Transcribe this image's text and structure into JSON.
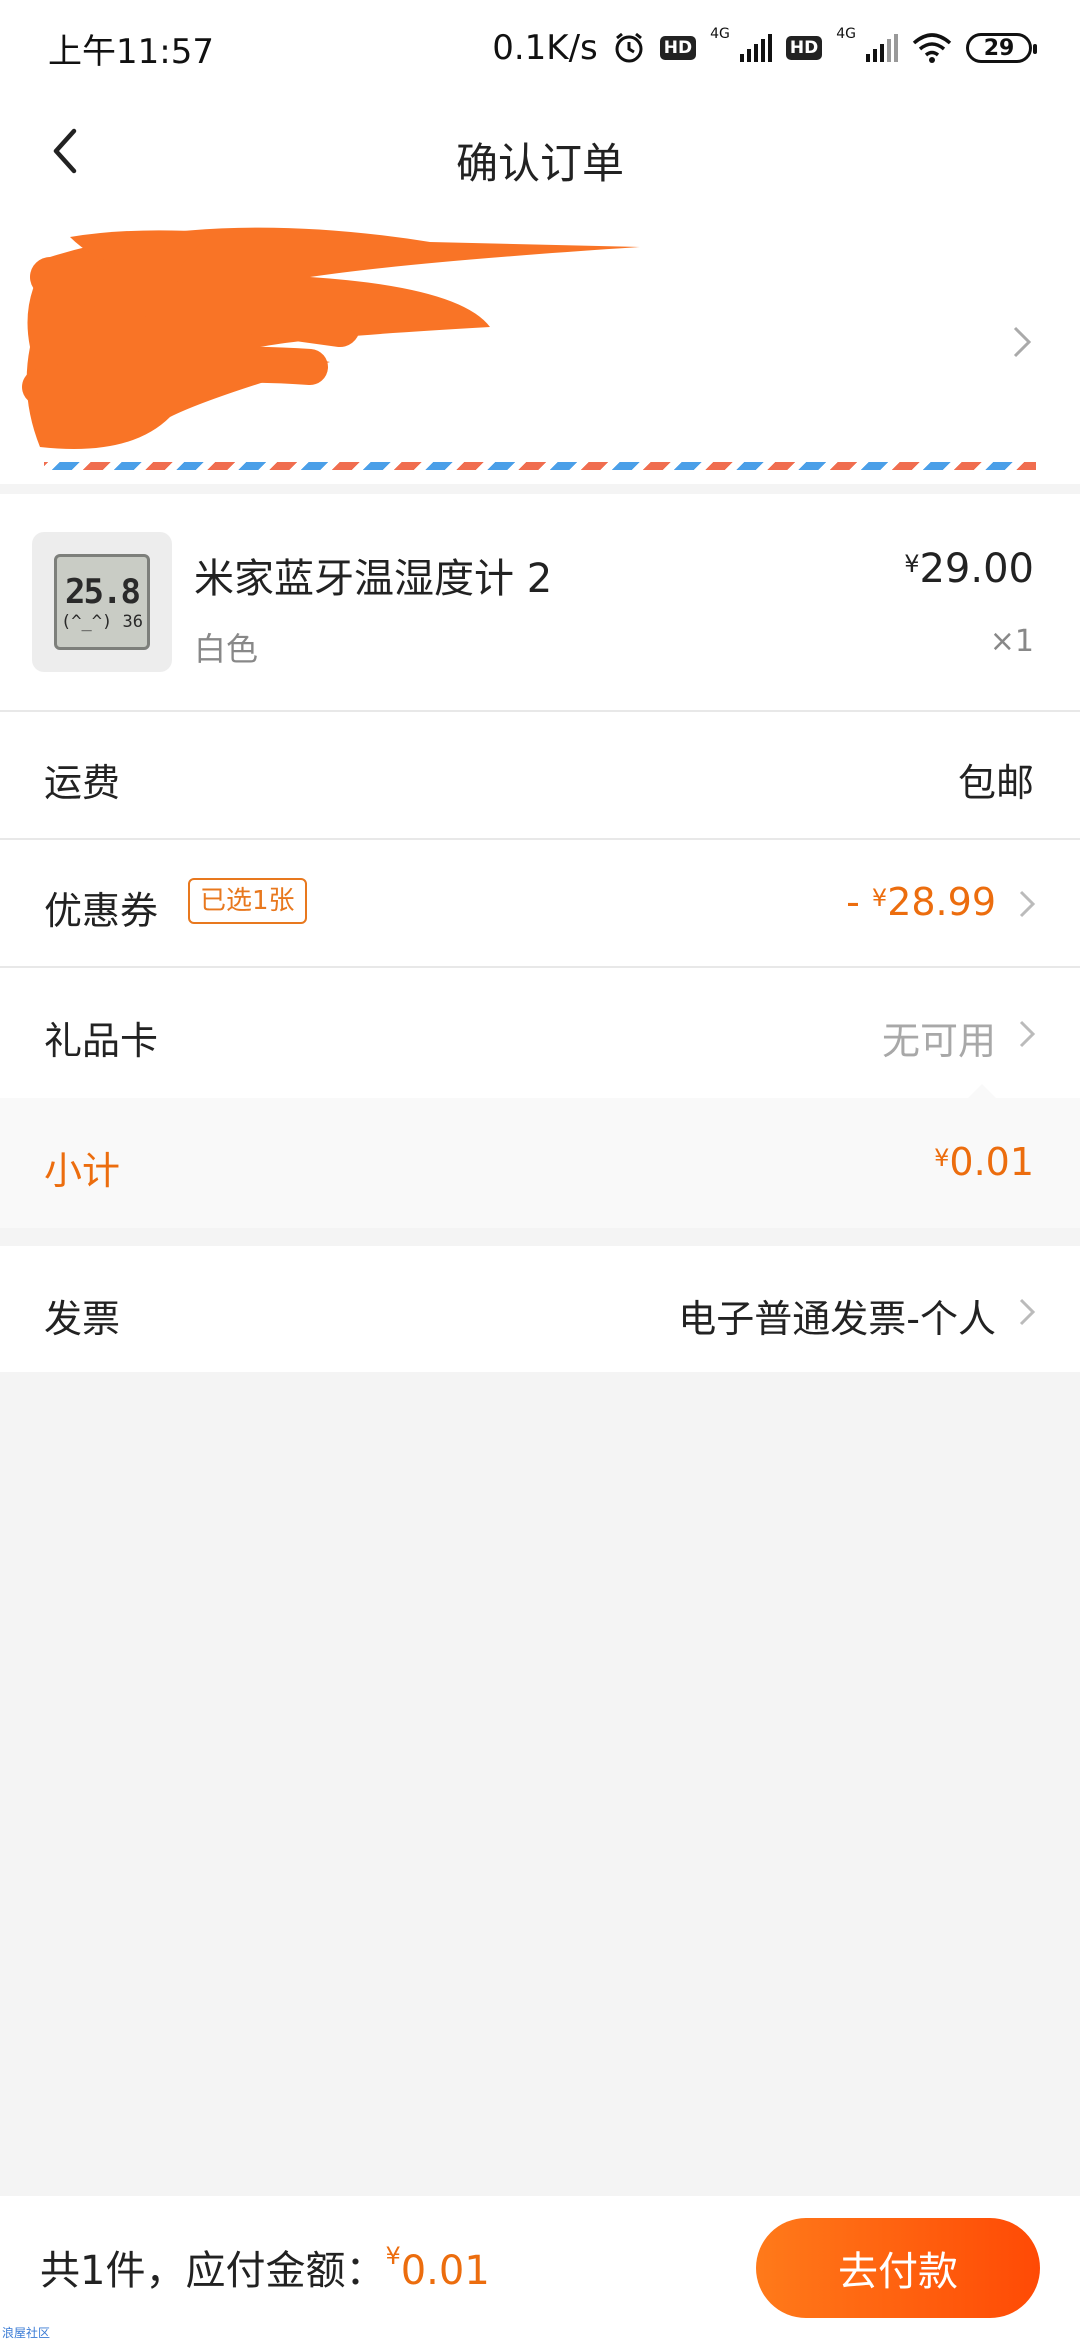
{
  "status_bar": {
    "time": "上午11:57",
    "net_speed": "0.1K/s",
    "hd1": "HD",
    "net1": "4G",
    "hd2": "HD",
    "net2": "4G",
    "battery": "29",
    "icons": [
      "alarm-icon",
      "signal-icon",
      "wifi-icon",
      "battery-icon"
    ]
  },
  "header": {
    "title": "确认订单"
  },
  "product": {
    "name": "米家蓝牙温湿度计 2",
    "variant": "白色",
    "price_symbol": "¥",
    "price": "29.00",
    "quantity": "×1",
    "thumb_temp": "25.8",
    "thumb_humidity": "(^_^) 36"
  },
  "shipping": {
    "label": "运费",
    "value": "包邮"
  },
  "coupon": {
    "label": "优惠券",
    "tag": "已选1张",
    "value_prefix": "- ",
    "value_symbol": "¥",
    "value": "28.99"
  },
  "gift_card": {
    "label": "礼品卡",
    "value": "无可用"
  },
  "subtotal": {
    "label": "小计",
    "symbol": "¥",
    "value": "0.01"
  },
  "invoice": {
    "label": "发票",
    "value": "电子普通发票-个人"
  },
  "footer": {
    "total_label": "共1件，应付金额：",
    "total_symbol": "¥",
    "total_value": "0.01",
    "pay_button": "去付款"
  },
  "watermark": "浪屋社区",
  "colors": {
    "accent": "#ec6d0e",
    "pay_button_start": "#ff7a1a",
    "pay_button_end": "#ff4a05",
    "redaction": "#f97426"
  }
}
